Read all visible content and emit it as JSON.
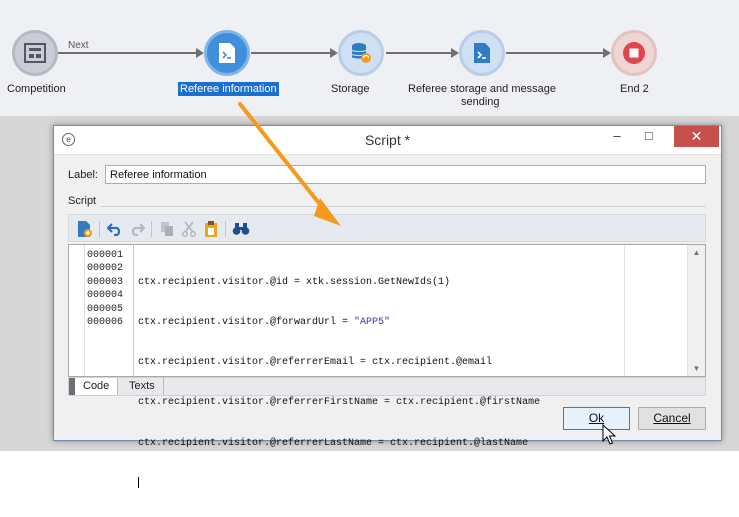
{
  "workflow": {
    "link_label": "Next",
    "nodes": [
      {
        "label": "Competition"
      },
      {
        "label": "Referee information"
      },
      {
        "label": "Storage"
      },
      {
        "label_line1": "Referee storage and message",
        "label_line2": "sending"
      },
      {
        "label": "End 2"
      }
    ]
  },
  "dialog": {
    "title": "Script *",
    "minimize": "–",
    "maximize": "□",
    "close": "✕",
    "label_caption": "Label:",
    "label_value": "Referee information",
    "script_caption": "Script",
    "toolbar_icons": [
      "insert-field-icon",
      "undo-icon",
      "redo-icon",
      "copy-icon",
      "cut-icon",
      "paste-icon",
      "find-icon"
    ],
    "line_numbers": [
      "000001",
      "000002",
      "000003",
      "000004",
      "000005",
      "000006"
    ],
    "code": {
      "l1": "ctx.recipient.visitor.@id = xtk.session.GetNewIds(1)",
      "l2_pre": "ctx.recipient.visitor.@forwardUrl = ",
      "l2_str": "\"APP5\"",
      "l3": "ctx.recipient.visitor.@referrerEmail = ctx.recipient.@email",
      "l4": "ctx.recipient.visitor.@referrerFirstName = ctx.recipient.@firstName",
      "l5": "ctx.recipient.visitor.@referrerLastName = ctx.recipient.@lastName"
    },
    "tabs": [
      "Code",
      "Texts"
    ],
    "ok_label": "Ok",
    "cancel_label": "Cancel"
  },
  "colors": {
    "accent": "#3f8fdc",
    "arrow": "#f39a1f",
    "close_button": "#c7504d"
  }
}
